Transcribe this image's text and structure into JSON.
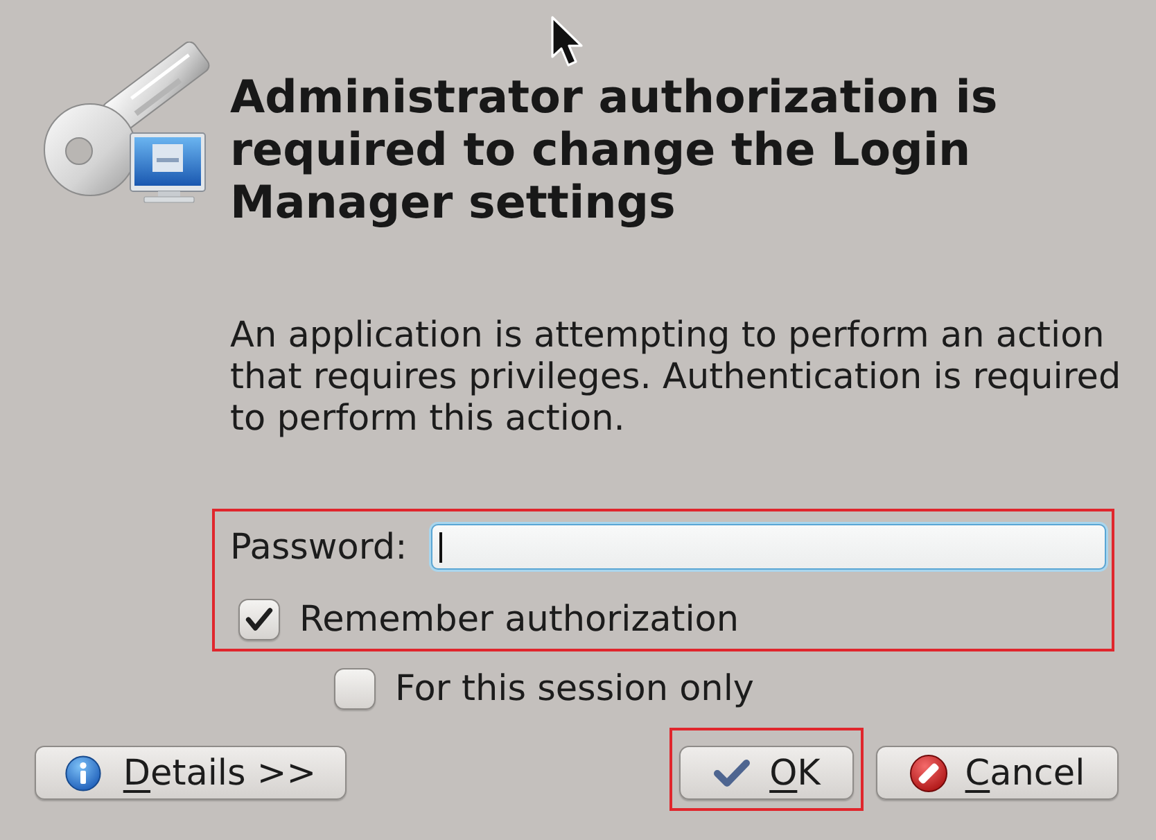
{
  "dialog": {
    "title": "Administrator authorization is required to change the Login Manager settings",
    "message": "An application is attempting to perform an action that requires privileges. Authentication is required to perform this action."
  },
  "credentials": {
    "highlighted": true,
    "password_label": "Password:",
    "password_focused": true,
    "remember": {
      "label": "Remember authorization",
      "checked": true
    }
  },
  "session_only": {
    "label": "For this session only",
    "checked": false
  },
  "buttons": [
    {
      "kind": "details",
      "label": "Details >>",
      "mnemonic_underlined": true,
      "highlighted": false
    },
    {
      "kind": "ok",
      "label": "OK",
      "mnemonic_underlined": true,
      "highlighted": true
    },
    {
      "kind": "cancel",
      "label": "Cancel",
      "mnemonic_underlined": true,
      "highlighted": false
    }
  ]
}
